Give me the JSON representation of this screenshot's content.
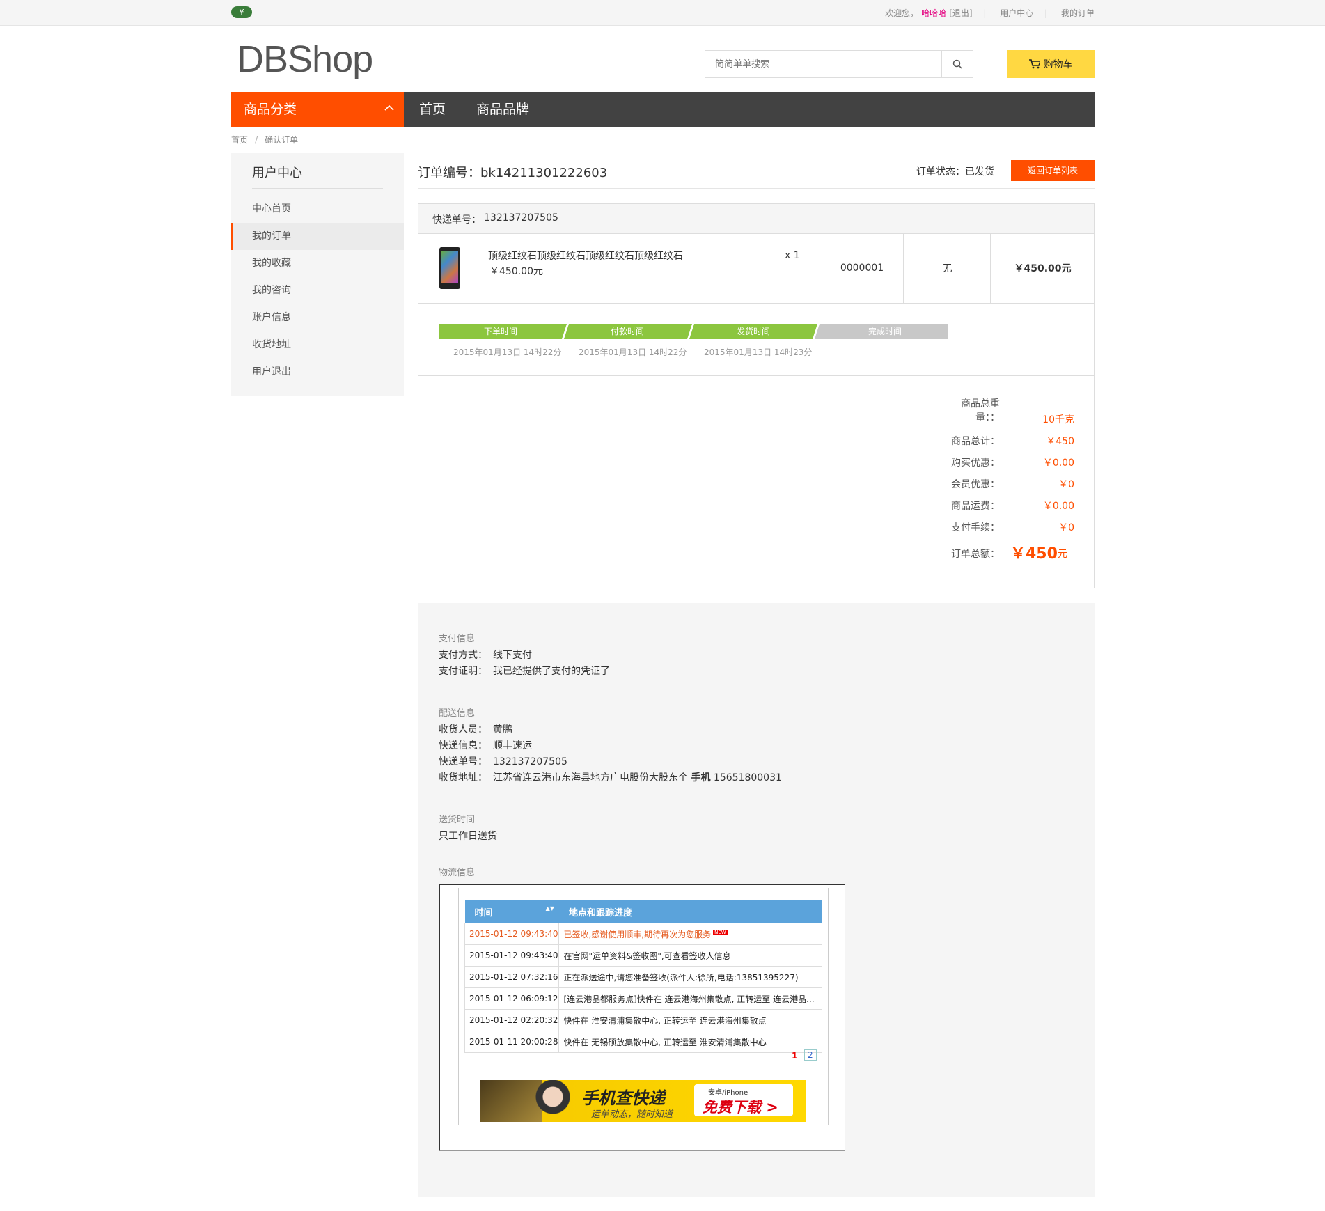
{
  "topbar": {
    "coin_symbol": "¥",
    "welcome": "欢迎您，",
    "username": "哈哈哈",
    "logout": "[退出]",
    "user_center": "用户中心",
    "my_orders": "我的订单"
  },
  "header": {
    "logo": "DBShop",
    "search_placeholder": "简简单单搜索",
    "cart_label": "购物车"
  },
  "nav": {
    "category": "商品分类",
    "links": [
      "首页",
      "商品品牌"
    ]
  },
  "breadcrumb": [
    "首页",
    "/",
    "确认订单"
  ],
  "sidebar": {
    "title": "用户中心",
    "items": [
      "中心首页",
      "我的订单",
      "我的收藏",
      "我的咨询",
      "账户信息",
      "收货地址",
      "用户退出"
    ],
    "active_index": 1
  },
  "order": {
    "number_label": "订单编号：",
    "number": "bk14211301222603",
    "status_label": "订单状态：",
    "status": "已发货",
    "back_button": "返回订单列表",
    "express_label": "快递单号：",
    "express_no": "132137207505"
  },
  "product": {
    "name": "顶级红纹石顶级红纹石顶级红纹石顶级红纹石",
    "price": "￥450.00元",
    "qty": "x 1",
    "sku": "0000001",
    "option": "无",
    "total": "￥450.00元"
  },
  "progress": {
    "steps": [
      {
        "label": "下单时间",
        "time": "2015年01月13日 14时22分",
        "done": true
      },
      {
        "label": "付款时间",
        "time": "2015年01月13日 14时22分",
        "done": true
      },
      {
        "label": "发货时间",
        "time": "2015年01月13日 14时23分",
        "done": true
      },
      {
        "label": "完成时间",
        "time": "",
        "done": false
      }
    ],
    "done_color": "#8cc63f",
    "todo_color": "#c8c8c8"
  },
  "summary": {
    "weight_label_1": "商品总重",
    "weight_label_2": "量：：",
    "weight": "10千克",
    "rows": [
      {
        "label": "商品总计：",
        "value": "￥450"
      },
      {
        "label": "购买优惠：",
        "value": "￥0.00"
      },
      {
        "label": "会员优惠：",
        "value": "￥0"
      },
      {
        "label": "商品运费：",
        "value": "￥0.00"
      },
      {
        "label": "支付手续：",
        "value": "￥0"
      }
    ],
    "total_label": "订单总额：",
    "total_value": "￥450",
    "total_unit": "元"
  },
  "info": {
    "pay_heading": "支付信息",
    "pay_method_label": "支付方式：",
    "pay_method": "线下支付",
    "pay_proof_label": "支付证明：",
    "pay_proof": "我已经提供了支付的凭证了",
    "ship_heading": "配送信息",
    "receiver_label": "收货人员：",
    "receiver": "黄鹏",
    "express_info_label": "快递信息：",
    "express_info": "顺丰速运",
    "express_no_label": "快递单号：",
    "express_no": "132137207505",
    "address_label": "收货地址：",
    "address": "江苏省连云港市东海县地方广电股份大股东个",
    "phone_label": "手机",
    "phone": "15651800031",
    "delivery_heading": "送货时间",
    "delivery": "只工作日送货",
    "logistics_heading": "物流信息"
  },
  "tracking": {
    "headers": [
      "时间",
      "地点和跟踪进度"
    ],
    "rows": [
      {
        "time": "2015-01-12 09:43:40",
        "desc": "已签收,感谢使用顺丰,期待再次为您服务"
      },
      {
        "time": "2015-01-12 09:43:40",
        "desc": "在官网\"运单资料&签收图\",可查看签收人信息"
      },
      {
        "time": "2015-01-12 07:32:16",
        "desc": "正在派送途中,请您准备签收(派件人:徐所,电话:13851395227)"
      },
      {
        "time": "2015-01-12 06:09:12",
        "desc": "[连云港晶都服务点]快件在 连云港海州集散点, 正转运至 连云港晶..."
      },
      {
        "time": "2015-01-12 02:20:32",
        "desc": "快件在 淮安清浦集散中心, 正转运至 连云港海州集散点"
      },
      {
        "time": "2015-01-11 20:00:28",
        "desc": "快件在 无锡硕放集散中心, 正转运至 淮安清浦集散中心"
      }
    ],
    "new_badge": "NEW",
    "pages": [
      "1",
      "2"
    ],
    "banner_title": "手机查快递",
    "banner_sub": "运单动态，随时知道",
    "banner_platform": "安卓/iPhone",
    "banner_cta": "免费下载 >"
  }
}
